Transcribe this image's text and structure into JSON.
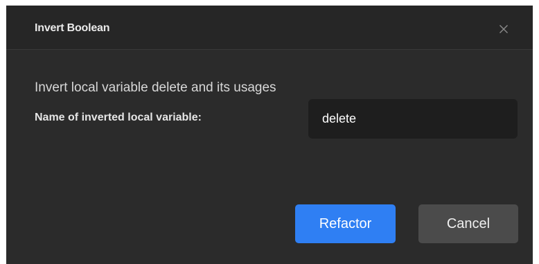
{
  "dialog": {
    "title": "Invert Boolean",
    "description": "Invert local variable delete and its usages",
    "field": {
      "label": "Name of inverted local variable:",
      "value": "delete"
    },
    "buttons": {
      "primary_label": "Refactor",
      "secondary_label": "Cancel"
    },
    "icons": {
      "close": "close-icon"
    },
    "colors": {
      "background": "#2b2b2b",
      "header": "#262626",
      "input": "#1e1e1e",
      "primary": "#2f7ff3",
      "secondary": "#4b4b4b"
    }
  }
}
